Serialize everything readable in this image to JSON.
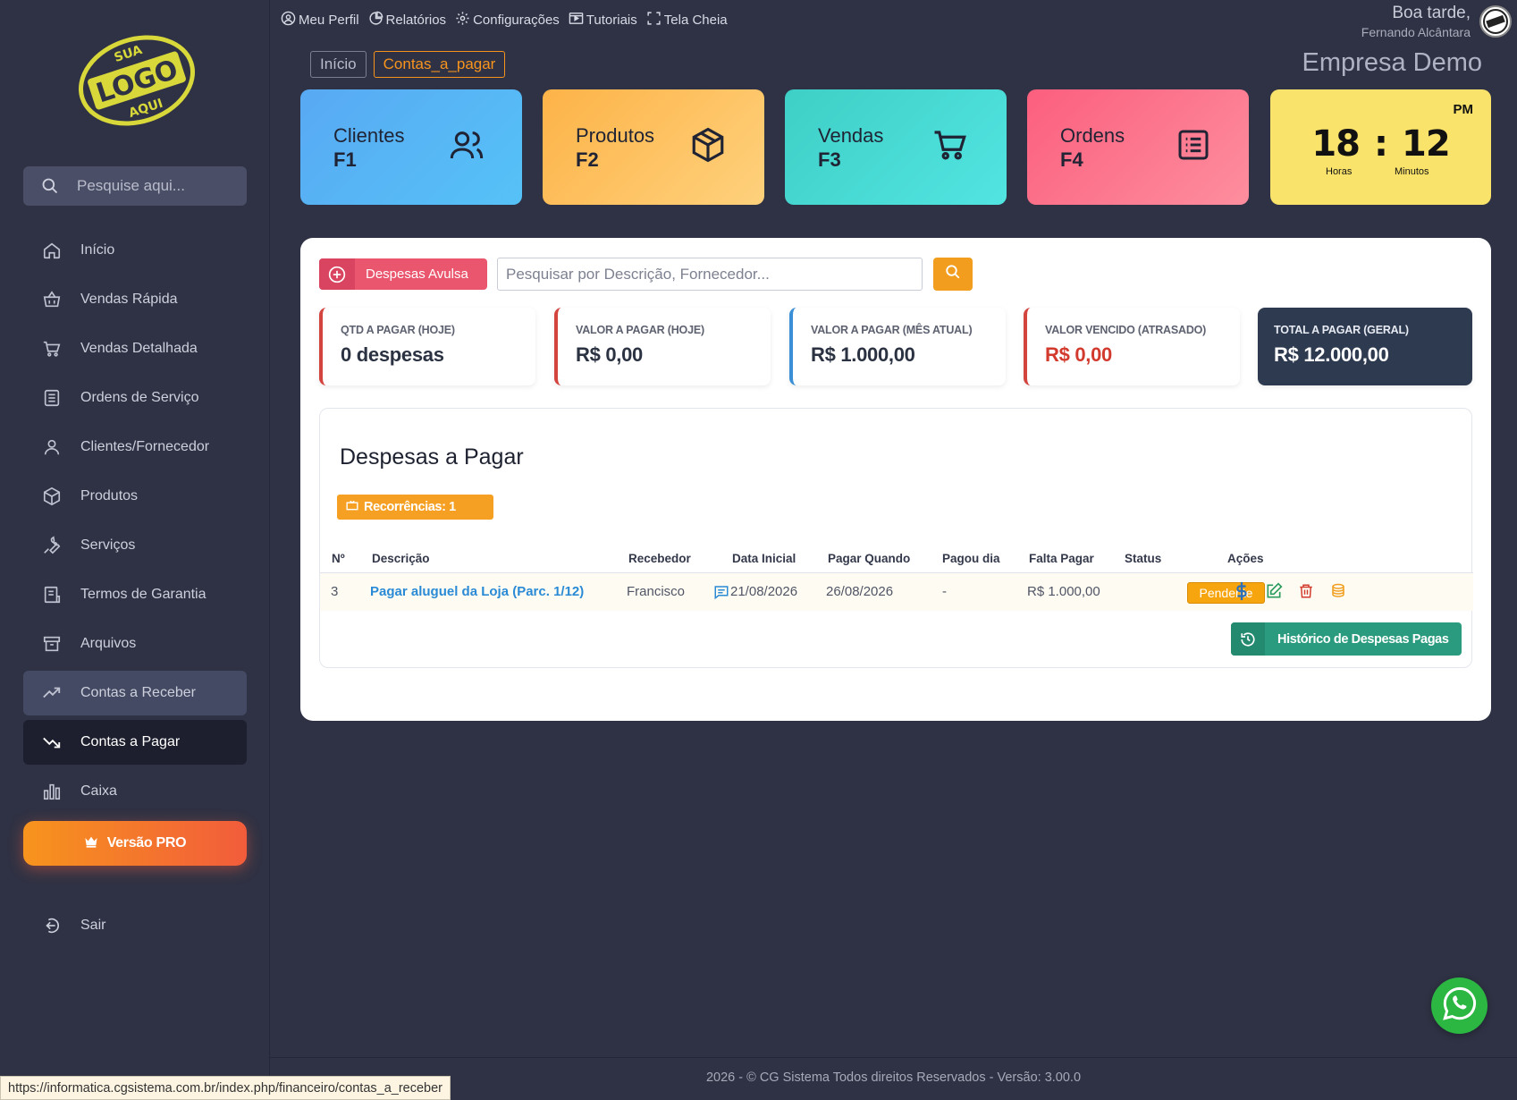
{
  "sidebar": {
    "search_placeholder": "Pesquise aqui...",
    "items": [
      {
        "label": "Início"
      },
      {
        "label": "Vendas Rápida"
      },
      {
        "label": "Vendas Detalhada"
      },
      {
        "label": "Ordens de Serviço"
      },
      {
        "label": "Clientes/Fornecedor"
      },
      {
        "label": "Produtos"
      },
      {
        "label": "Serviços"
      },
      {
        "label": "Termos de Garantia"
      },
      {
        "label": "Arquivos"
      },
      {
        "label": "Contas a Receber"
      },
      {
        "label": "Contas a Pagar"
      },
      {
        "label": "Caixa"
      }
    ],
    "pro_label": "Versão PRO",
    "logout_label": "Sair"
  },
  "topmenu": {
    "profile": "Meu Perfil",
    "reports": "Relatórios",
    "settings": "Configurações",
    "tutorials": "Tutoriais",
    "fullscreen": "Tela Cheia"
  },
  "header": {
    "greeting": "Boa tarde,",
    "user": "Fernando Alcântara",
    "company": "Empresa Demo"
  },
  "breadcrumb": {
    "home": "Início",
    "current": "Contas_a_pagar"
  },
  "shortcuts": [
    {
      "label": "Clientes",
      "key": "F1"
    },
    {
      "label": "Produtos",
      "key": "F2"
    },
    {
      "label": "Vendas",
      "key": "F3"
    },
    {
      "label": "Ordens",
      "key": "F4"
    }
  ],
  "clock": {
    "ampm": "PM",
    "hours": "18",
    "minutes": "12",
    "hours_label": "Horas",
    "minutes_label": "Minutos"
  },
  "toolbar": {
    "add_label": "Despesas Avulsa",
    "search_placeholder": "Pesquisar por Descrição, Fornecedor..."
  },
  "stats": [
    {
      "title": "QTD A PAGAR (HOJE)",
      "value": "0 despesas"
    },
    {
      "title": "VALOR A PAGAR (HOJE)",
      "value": "R$ 0,00"
    },
    {
      "title": "VALOR A PAGAR (MÊS ATUAL)",
      "value": "R$ 1.000,00"
    },
    {
      "title": "VALOR VENCIDO (ATRASADO)",
      "value": "R$ 0,00"
    },
    {
      "title": "TOTAL A PAGAR (GERAL)",
      "value": "R$ 12.000,00"
    }
  ],
  "table": {
    "title": "Despesas a Pagar",
    "recurrences": "Recorrências: 1",
    "columns": [
      "Nº",
      "Descrição",
      "Recebedor",
      "Data Inicial",
      "Pagar Quando",
      "Pagou dia",
      "Falta Pagar",
      "Status",
      "Ações"
    ],
    "rows": [
      {
        "num": "3",
        "desc": "Pagar aluguel da Loja (Parc. 1/12)",
        "receiver": "Francisco",
        "start": "21/08/2026",
        "due": "26/08/2026",
        "paid": "-",
        "remaining": "R$ 1.000,00",
        "status": "Pendente"
      }
    ],
    "history_label": "Histórico de Despesas Pagas"
  },
  "footer": "2026 - © CG Sistema Todos direitos Reservados - Versão: 3.00.0",
  "statusbar": "https://informatica.cgsistema.com.br/index.php/financeiro/contas_a_receber",
  "colors": {
    "accent_orange": "#f7941d",
    "danger": "#d4443f",
    "success": "#2a9b7e",
    "link": "#2a8ad6"
  }
}
